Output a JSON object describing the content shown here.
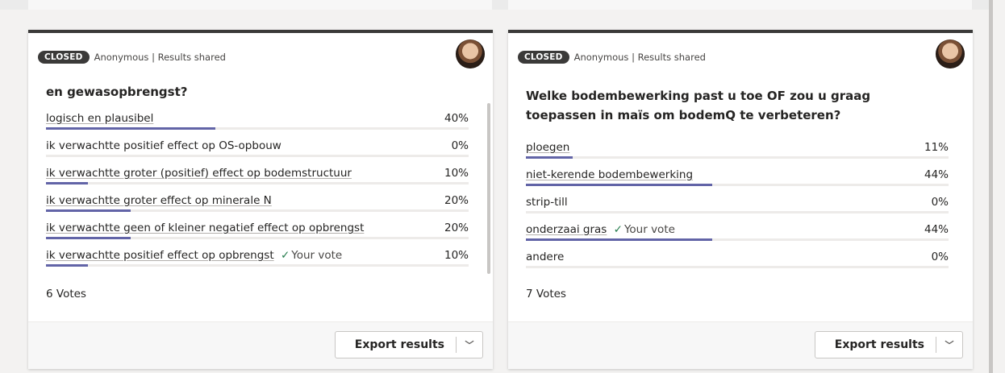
{
  "polls": [
    {
      "status": "CLOSED",
      "meta": "Anonymous | Results shared",
      "question": "en gewasopbrengst?",
      "options": [
        {
          "label": "logisch en plausibel",
          "pct": "40%",
          "value": 40,
          "your_vote": ""
        },
        {
          "label": "ik verwachtte positief effect op OS-opbouw",
          "pct": "0%",
          "value": 0,
          "your_vote": ""
        },
        {
          "label": "ik verwachtte groter (positief) effect op bodemstructuur",
          "pct": "10%",
          "value": 10,
          "your_vote": ""
        },
        {
          "label": "ik verwachtte groter effect op minerale N",
          "pct": "20%",
          "value": 20,
          "your_vote": ""
        },
        {
          "label": "ik verwachtte geen of kleiner negatief effect op opbrengst",
          "pct": "20%",
          "value": 20,
          "your_vote": ""
        },
        {
          "label": "ik verwachtte positief effect op opbrengst",
          "pct": "10%",
          "value": 10,
          "your_vote": "Your vote"
        }
      ],
      "votes": "6 Votes",
      "export_label": "Export results"
    },
    {
      "status": "CLOSED",
      "meta": "Anonymous | Results shared",
      "question": "Welke bodembewerking past u toe OF zou u graag toepassen in maïs om bodemQ te verbeteren?",
      "options": [
        {
          "label": "ploegen",
          "pct": "11%",
          "value": 11,
          "your_vote": ""
        },
        {
          "label": "niet-kerende bodembewerking",
          "pct": "44%",
          "value": 44,
          "your_vote": ""
        },
        {
          "label": "strip-till",
          "pct": "0%",
          "value": 0,
          "your_vote": ""
        },
        {
          "label": "onderzaai gras",
          "pct": "44%",
          "value": 44,
          "your_vote": "Your vote"
        },
        {
          "label": "andere",
          "pct": "0%",
          "value": 0,
          "your_vote": ""
        }
      ],
      "votes": "7 Votes",
      "export_label": "Export results"
    }
  ],
  "icons": {
    "check": "checkmark-icon",
    "chevron": "chevron-down-icon",
    "avatar": "user-avatar"
  }
}
